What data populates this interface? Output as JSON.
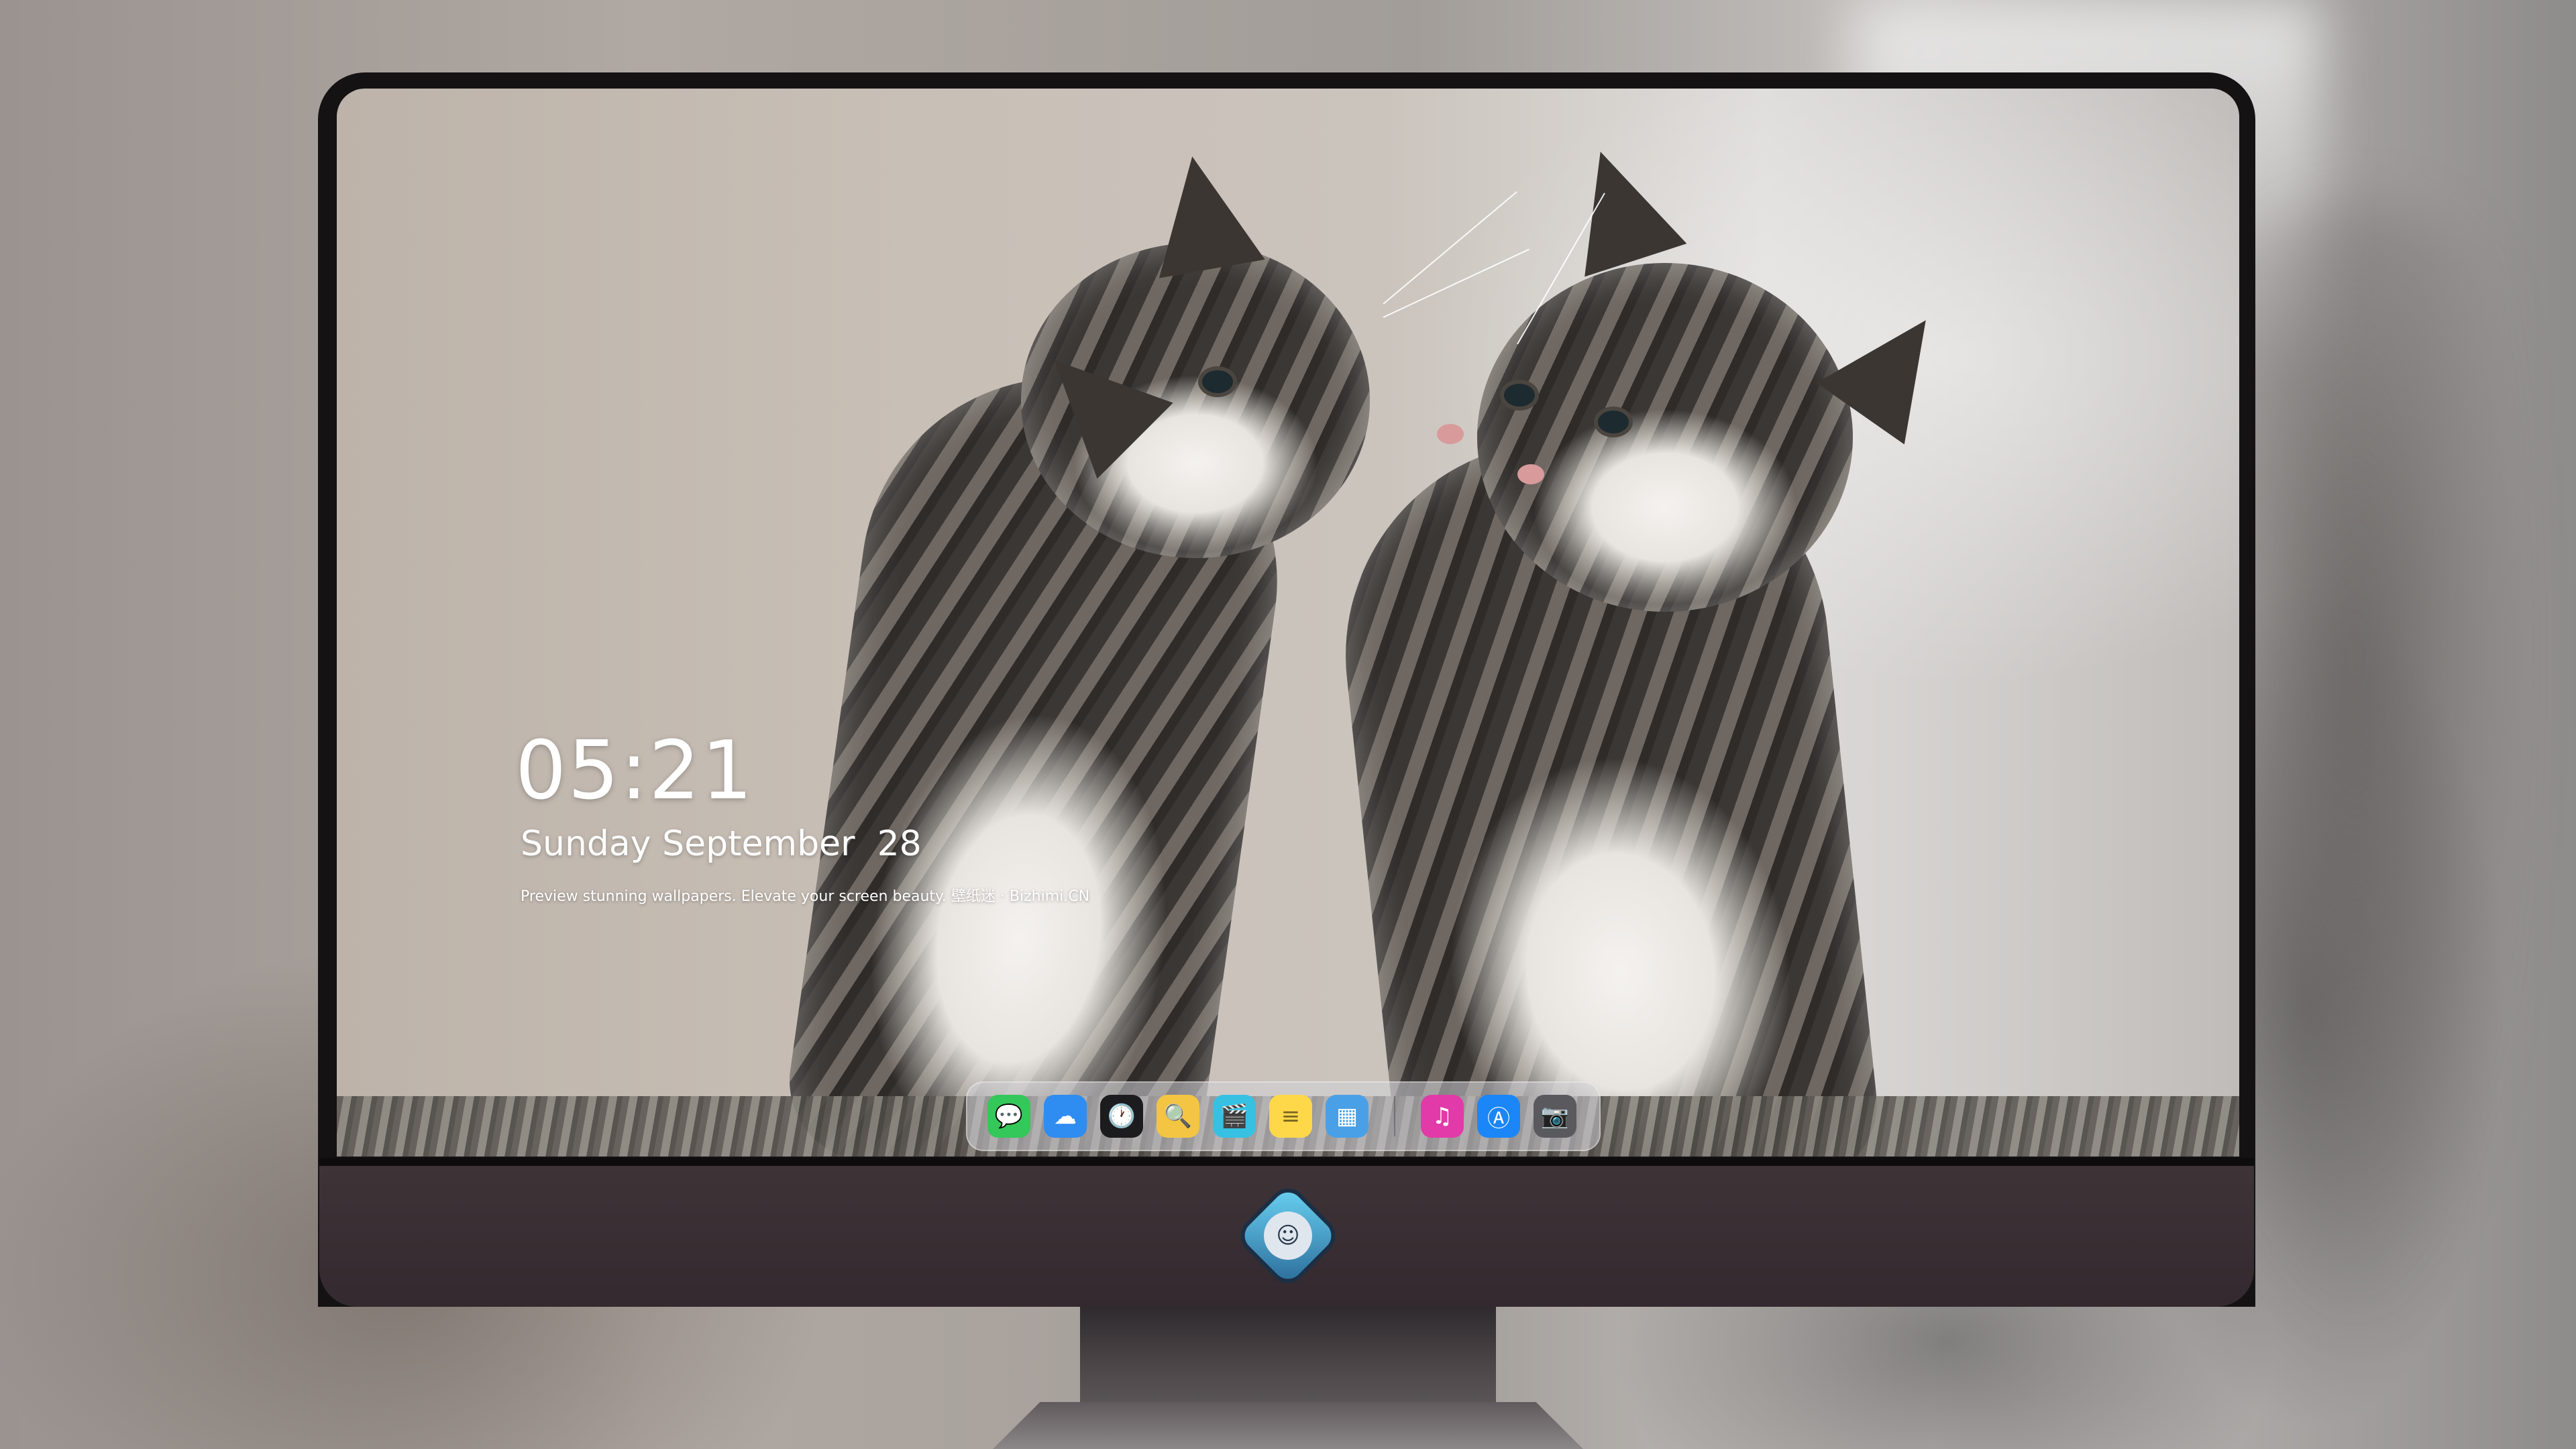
{
  "lockscreen": {
    "time": "05:21",
    "date": "Sunday September  28",
    "tagline": "Preview stunning wallpapers. Elevate your screen beauty. 壁纸迷 · Bizhimi.CN"
  },
  "dock": {
    "apps": [
      {
        "name": "messages-icon",
        "glyph": "💬",
        "color": "#34c759"
      },
      {
        "name": "weather-icon",
        "glyph": "☁",
        "color": "#2f8cf0"
      },
      {
        "name": "clock-icon",
        "glyph": "🕐",
        "color": "#1c1c1e"
      },
      {
        "name": "preview-icon",
        "glyph": "🔍",
        "color": "#f4c542"
      },
      {
        "name": "video-clapper-icon",
        "glyph": "🎬",
        "color": "#36c1e3"
      },
      {
        "name": "notes-icon",
        "glyph": "≡",
        "color": "#ffd84a"
      },
      {
        "name": "photo-editor-icon",
        "glyph": "▦",
        "color": "#4aa0e6"
      },
      {
        "name": "music-icon",
        "glyph": "♫",
        "color": "#e23aa8"
      },
      {
        "name": "app-store-icon",
        "glyph": "Ⓐ",
        "color": "#1b86f7"
      },
      {
        "name": "camera-icon",
        "glyph": "📷",
        "color": "#5a5a5e"
      }
    ]
  },
  "brand": {
    "logo": "dragon-mascot-logo",
    "logo_glyph": "☺"
  }
}
